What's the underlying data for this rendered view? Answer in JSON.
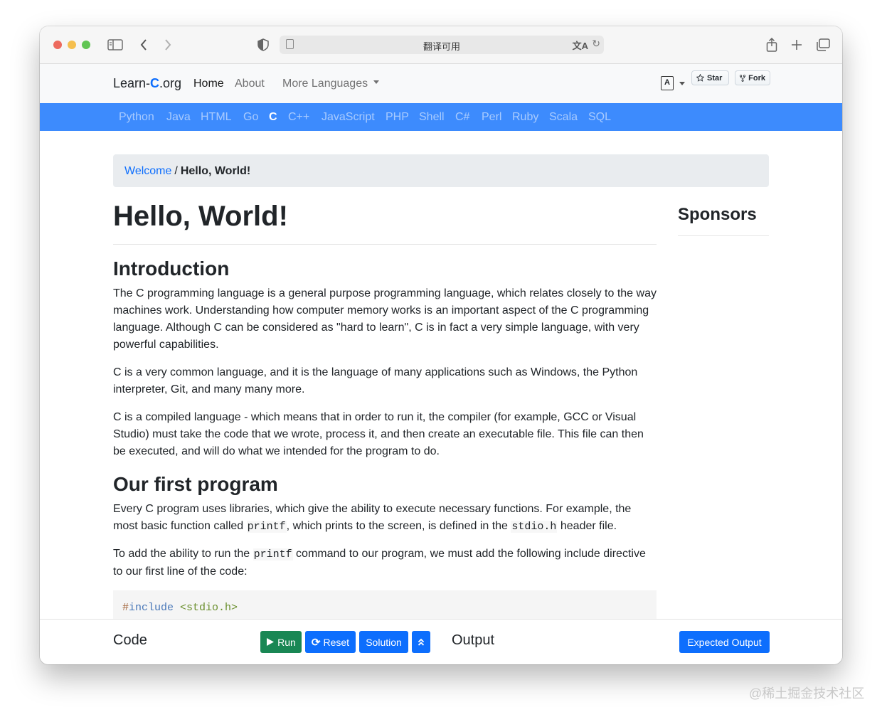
{
  "browser": {
    "url_text": "翻译可用"
  },
  "navbar": {
    "brand_prefix": "Learn-",
    "brand_c": "C",
    "brand_suffix": ".org",
    "links": [
      "Home",
      "About",
      "More Languages"
    ],
    "lang_glyph": "A",
    "star_label": "Star",
    "fork_label": "Fork"
  },
  "languages": [
    "Python",
    "Java",
    "HTML",
    "Go",
    "C",
    "C++",
    "JavaScript",
    "PHP",
    "Shell",
    "C#",
    "Perl",
    "Ruby",
    "Scala",
    "SQL"
  ],
  "active_language": "C",
  "breadcrumb": {
    "link": "Welcome",
    "separator": "/",
    "current": "Hello, World!"
  },
  "content": {
    "title": "Hello, World!",
    "intro_heading": "Introduction",
    "intro_p1": "The C programming language is a general purpose programming language, which relates closely to the way machines work. Understanding how computer memory works is an important aspect of the C programming language. Although C can be considered as \"hard to learn\", C is in fact a very simple language, with very powerful capabilities.",
    "intro_p2": "C is a very common language, and it is the language of many applications such as Windows, the Python interpreter, Git, and many many more.",
    "intro_p3": "C is a compiled language - which means that in order to run it, the compiler (for example, GCC or Visual Studio) must take the code that we wrote, process it, and then create an executable file. This file can then be executed, and will do what we intended for the program to do.",
    "program_heading": "Our first program",
    "program_p1_a": "Every C program uses libraries, which give the ability to execute necessary functions. For example, the most basic function called ",
    "program_p1_code1": "printf",
    "program_p1_b": ", which prints to the screen, is defined in the ",
    "program_p1_code2": "stdio.h",
    "program_p1_c": " header file.",
    "program_p2_a": "To add the ability to run the ",
    "program_p2_code": "printf",
    "program_p2_b": " command to our program, we must add the following include directive to our first line of the code:",
    "code_hash": "#",
    "code_include": "include",
    "code_header": " <stdio.h>"
  },
  "sidebar": {
    "sponsors_title": "Sponsors"
  },
  "bottom": {
    "code_label": "Code",
    "run_label": "Run",
    "reset_label": "Reset",
    "solution_label": "Solution",
    "output_label": "Output",
    "expected_output_label": "Expected Output"
  },
  "watermark": "@稀土掘金技术社区",
  "colors": {
    "primary": "#0d6efd",
    "language_bar": "#3d8bfd",
    "run_button": "#198754"
  }
}
